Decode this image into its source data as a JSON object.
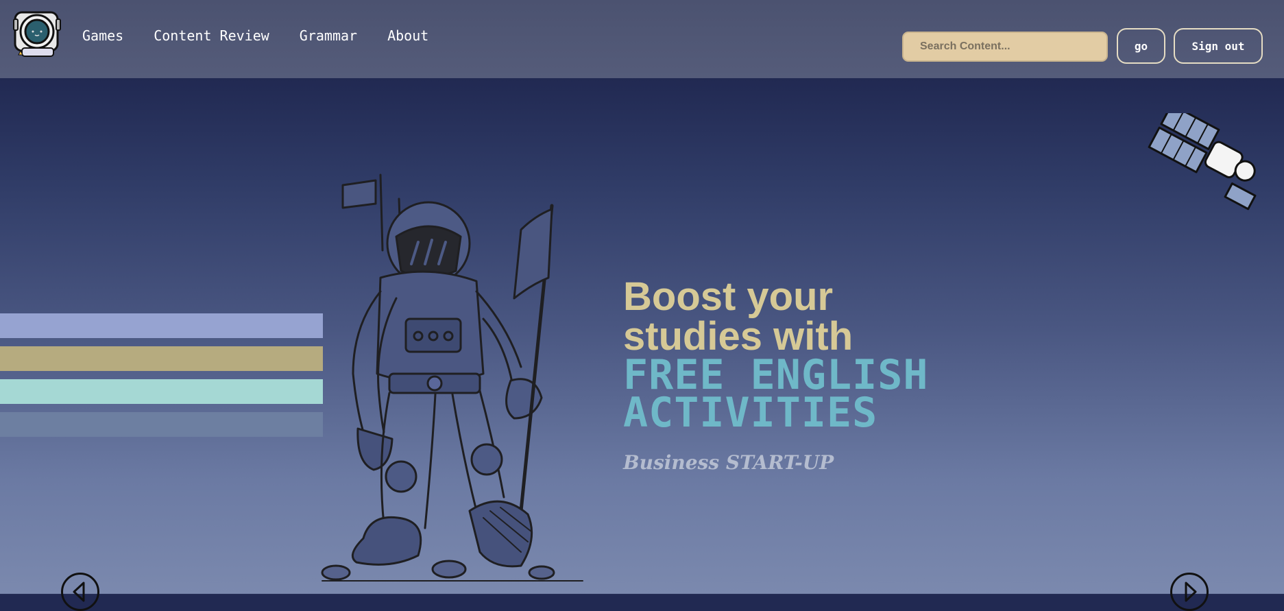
{
  "nav": {
    "logo_icon": "astronaut-logo-icon",
    "links": [
      "Games",
      "Content Review",
      "Grammar",
      "About"
    ]
  },
  "search": {
    "placeholder": "Search Content...",
    "value": ""
  },
  "buttons": {
    "go_label": "go",
    "signout_label": "Sign out"
  },
  "hero": {
    "line1": "Boost your",
    "line2": "studies with",
    "accent_line1": "FREE ENGLISH",
    "accent_line2": "ACTIVITIES",
    "subtitle": "Business START-UP"
  },
  "stripes": {
    "colors": [
      "#96a3d1",
      "#b6ab7f",
      "#a5d8d4",
      "#6d7fa1"
    ]
  },
  "carousel": {
    "prev_icon": "chevron-left-icon",
    "next_icon": "chevron-right-icon"
  },
  "illustrations": {
    "astronaut": "astronaut-with-flag-illustration",
    "satellite": "satellite-illustration"
  },
  "colors": {
    "accent_gold": "#d6c996",
    "accent_teal": "#6fb8c8",
    "navbar": "#4f5675",
    "search_bg": "#e2cca4"
  }
}
